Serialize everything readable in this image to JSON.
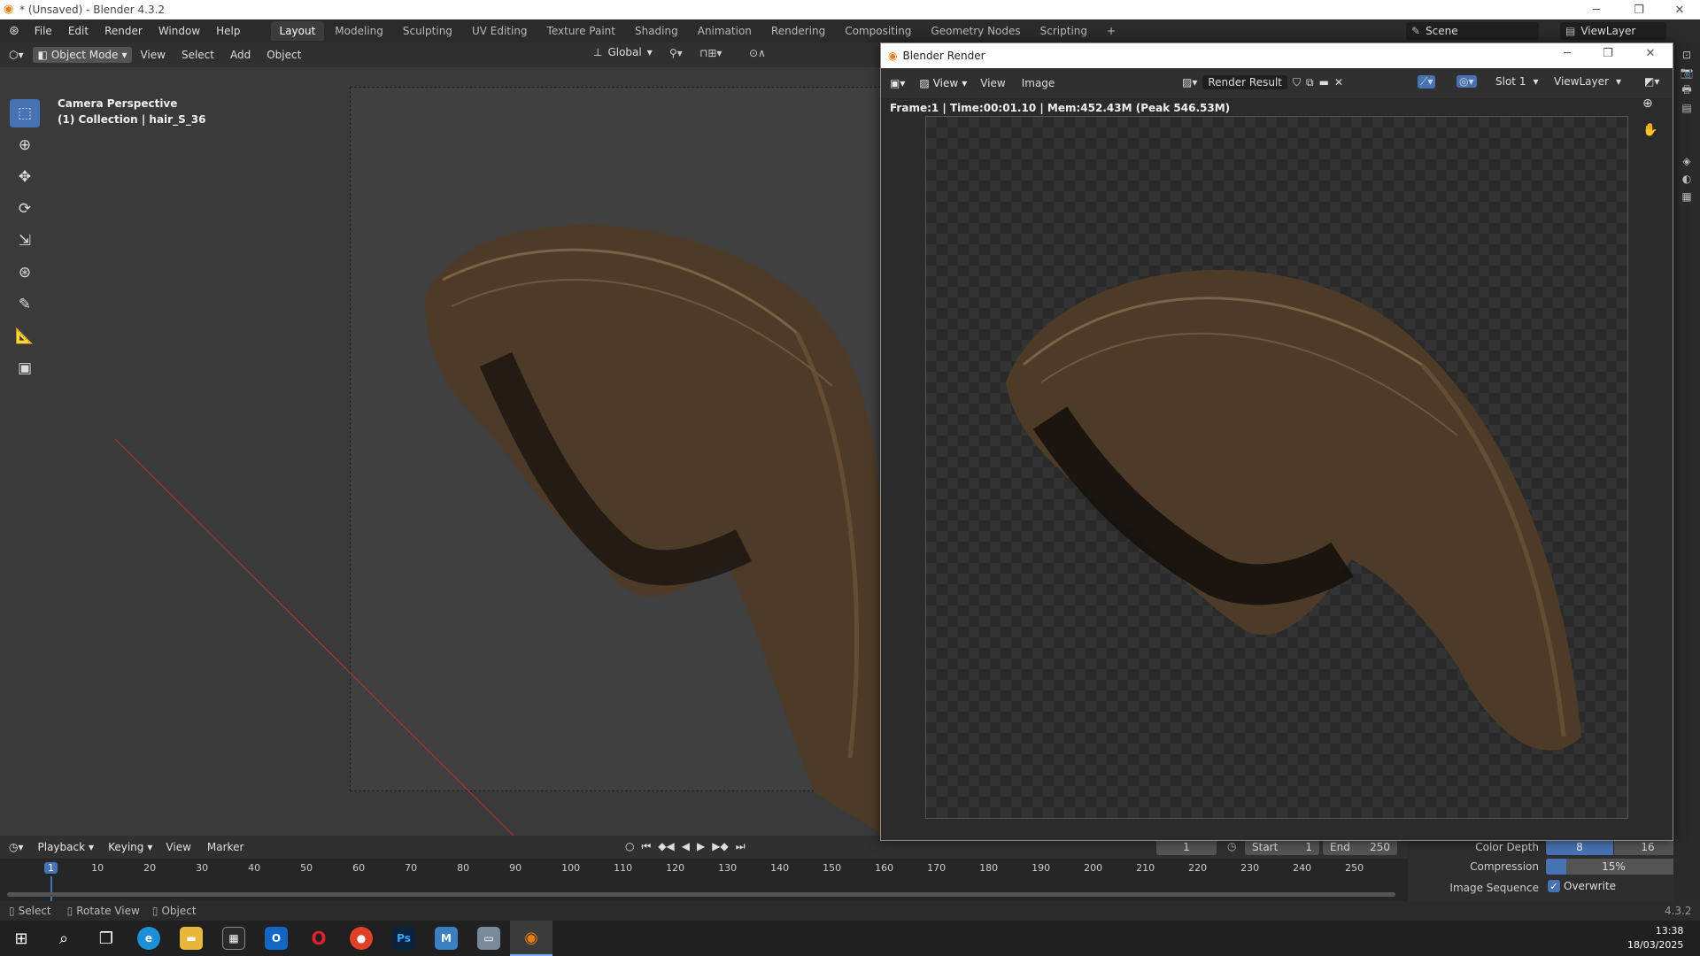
{
  "window": {
    "title": "* (Unsaved) - Blender 4.3.2",
    "minimize": "─",
    "maximize": "❐",
    "close": "✕"
  },
  "menu": {
    "items": [
      "File",
      "Edit",
      "Render",
      "Window",
      "Help"
    ]
  },
  "workspaces": {
    "tabs": [
      "Layout",
      "Modeling",
      "Sculpting",
      "UV Editing",
      "Texture Paint",
      "Shading",
      "Animation",
      "Rendering",
      "Compositing",
      "Geometry Nodes",
      "Scripting"
    ],
    "active": "Layout",
    "add": "+"
  },
  "topright": {
    "scene": "Scene",
    "viewlayer": "ViewLayer"
  },
  "viewport": {
    "mode": "Object Mode",
    "menus": [
      "View",
      "Select",
      "Add",
      "Object"
    ],
    "orientation": "Global",
    "overlay_title": "Camera Perspective",
    "overlay_collection": "(1) Collection | hair_S_36"
  },
  "render_window": {
    "title": "Blender Render",
    "menus": [
      "View",
      "View",
      "Image"
    ],
    "result": "Render Result",
    "slot": "Slot 1",
    "viewlayer": "ViewLayer",
    "stats": "Frame:1 | Time:00:01.10 | Mem:452.43M (Peak 546.53M)"
  },
  "timeline": {
    "menus": [
      "Playback",
      "Keying",
      "View",
      "Marker"
    ],
    "current_frame": "1",
    "start_label": "Start",
    "start": "1",
    "end_label": "End",
    "end": "250",
    "ticks": [
      "1",
      "10",
      "20",
      "30",
      "40",
      "50",
      "60",
      "70",
      "80",
      "90",
      "100",
      "110",
      "120",
      "130",
      "140",
      "150",
      "160",
      "170",
      "180",
      "190",
      "200",
      "210",
      "220",
      "230",
      "240",
      "250"
    ]
  },
  "properties": {
    "color_depth_label": "Color Depth",
    "color_depth_a": "8",
    "color_depth_b": "16",
    "compression_label": "Compression",
    "compression": "15%",
    "image_sequence_label": "Image Sequence",
    "overwrite": "Overwrite"
  },
  "statusbar": {
    "select": "Select",
    "rotate": "Rotate View",
    "object": "Object",
    "version": "4.3.2"
  },
  "taskbar": {
    "time": "13:38",
    "date": "18/03/2025"
  },
  "colors": {
    "accent": "#4772b3",
    "hair": "#6b5238"
  }
}
